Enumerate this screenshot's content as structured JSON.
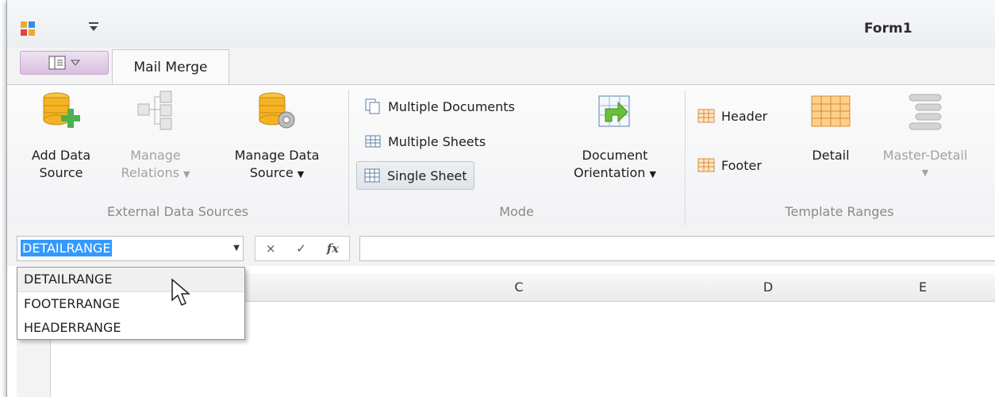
{
  "window": {
    "title": "Form1"
  },
  "tabs": [
    {
      "label": "Mail Merge",
      "active": true
    }
  ],
  "ribbon": {
    "external": {
      "caption": "External Data Sources",
      "add_data_source": {
        "line1": "Add Data",
        "line2": "Source"
      },
      "manage_relations": {
        "line1": "Manage",
        "line2": "Relations",
        "disabled": true
      },
      "manage_data_source": {
        "line1": "Manage Data",
        "line2": "Source"
      }
    },
    "mode": {
      "caption": "Mode",
      "multiple_documents": "Multiple Documents",
      "multiple_sheets": "Multiple Sheets",
      "single_sheet": "Single Sheet",
      "document_orientation": {
        "line1": "Document",
        "line2": "Orientation"
      }
    },
    "template": {
      "caption": "Template Ranges",
      "header": "Header",
      "footer": "Footer",
      "detail": "Detail",
      "master_detail": "Master-Detail"
    }
  },
  "formula_bar": {
    "name_box_value": "DETAILRANGE",
    "cancel_glyph": "×",
    "enter_glyph": "✓",
    "fx_glyph": "fx",
    "formula_value": ""
  },
  "name_dropdown": {
    "options": [
      "DETAILRANGE",
      "FOOTERRANGE",
      "HEADERRANGE"
    ]
  },
  "grid": {
    "columns": [
      "C",
      "D",
      "E"
    ]
  },
  "colors": {
    "accent": "#3399ff",
    "ribbon_icon_yellow": "#f5b324",
    "green_plus": "#4caf50"
  }
}
